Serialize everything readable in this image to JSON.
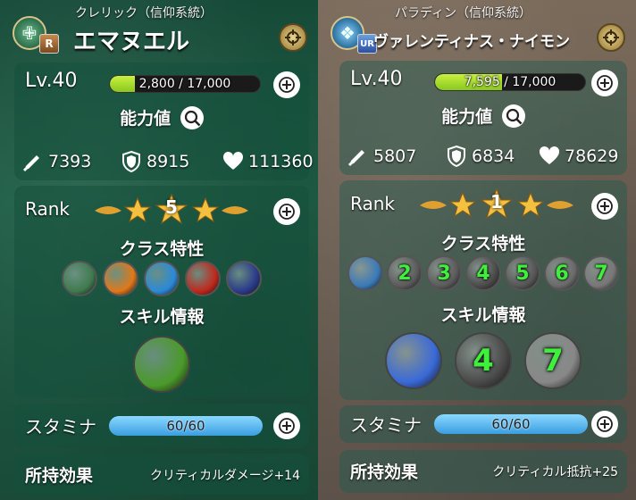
{
  "left": {
    "class_line": "クレリック（信仰系統）",
    "name": "エマヌエル",
    "rarity": "R",
    "level_label": "Lv.40",
    "xp_text": "2,800 / 17,000",
    "xp_fraction": 0.165,
    "stats_title": "能力値",
    "attack": "7393",
    "defense": "8915",
    "hp": "111360",
    "rank_label": "Rank",
    "rank_value": "5",
    "traits_title": "クラス特性",
    "traits": [
      {
        "icon": "cleric-icon",
        "text": "",
        "bg": "#3f7a4e"
      },
      {
        "icon": "heart-icon",
        "text": "",
        "bg": "#e0781a"
      },
      {
        "icon": "gem-icon",
        "text": "",
        "bg": "#2a8ad8"
      },
      {
        "icon": "sword-icon",
        "text": "",
        "bg": "#c0281c"
      },
      {
        "icon": "shield-grid-icon",
        "text": "",
        "bg": "#2a3a8a"
      }
    ],
    "skills_title": "スキル情報",
    "skills": [
      {
        "icon": "potion-icon",
        "text": "",
        "bg": "#4a9a2a"
      }
    ],
    "stamina_label": "スタミナ",
    "stamina_text": "60/60",
    "stamina_fraction": 1.0,
    "effect_label": "所持効果",
    "effect_value": "クリティカルダメージ+14"
  },
  "right": {
    "class_line": "パラディン（信仰系統）",
    "name": "ヴァレンティナス・ナイモン",
    "rarity": "UR",
    "level_label": "Lv.40",
    "xp_text": "7,595 / 17,000",
    "xp_fraction": 0.447,
    "stats_title": "能力値",
    "attack": "5807",
    "defense": "6834",
    "hp": "78629",
    "rank_label": "Rank",
    "rank_value": "1",
    "traits_title": "クラス特性",
    "traits": [
      {
        "icon": "paladin-icon",
        "text": "",
        "bg": "#3a7ab8"
      },
      {
        "icon": "locked-trait-icon",
        "text": "2",
        "bg": "#5a5a5a"
      },
      {
        "icon": "locked-trait-icon",
        "text": "3",
        "bg": "#5a5a5a"
      },
      {
        "icon": "locked-trait-icon",
        "text": "4",
        "bg": "#4a4a4a"
      },
      {
        "icon": "locked-trait-icon",
        "text": "5",
        "bg": "#555555"
      },
      {
        "icon": "locked-trait-icon",
        "text": "6",
        "bg": "#6a6a6a"
      },
      {
        "icon": "locked-trait-icon",
        "text": "7",
        "bg": "#777777"
      }
    ],
    "skills_title": "スキル情報",
    "skills": [
      {
        "icon": "holy-burst-icon",
        "text": "",
        "bg": "#3a6ad8"
      },
      {
        "icon": "locked-skill-icon",
        "text": "4",
        "bg": "#4a4a4a"
      },
      {
        "icon": "locked-skill-icon",
        "text": "7",
        "bg": "#888888"
      }
    ],
    "stamina_label": "スタミナ",
    "stamina_text": "60/60",
    "stamina_fraction": 1.0,
    "effect_label": "所持効果",
    "effect_value": "クリティカル抵抗+25"
  }
}
